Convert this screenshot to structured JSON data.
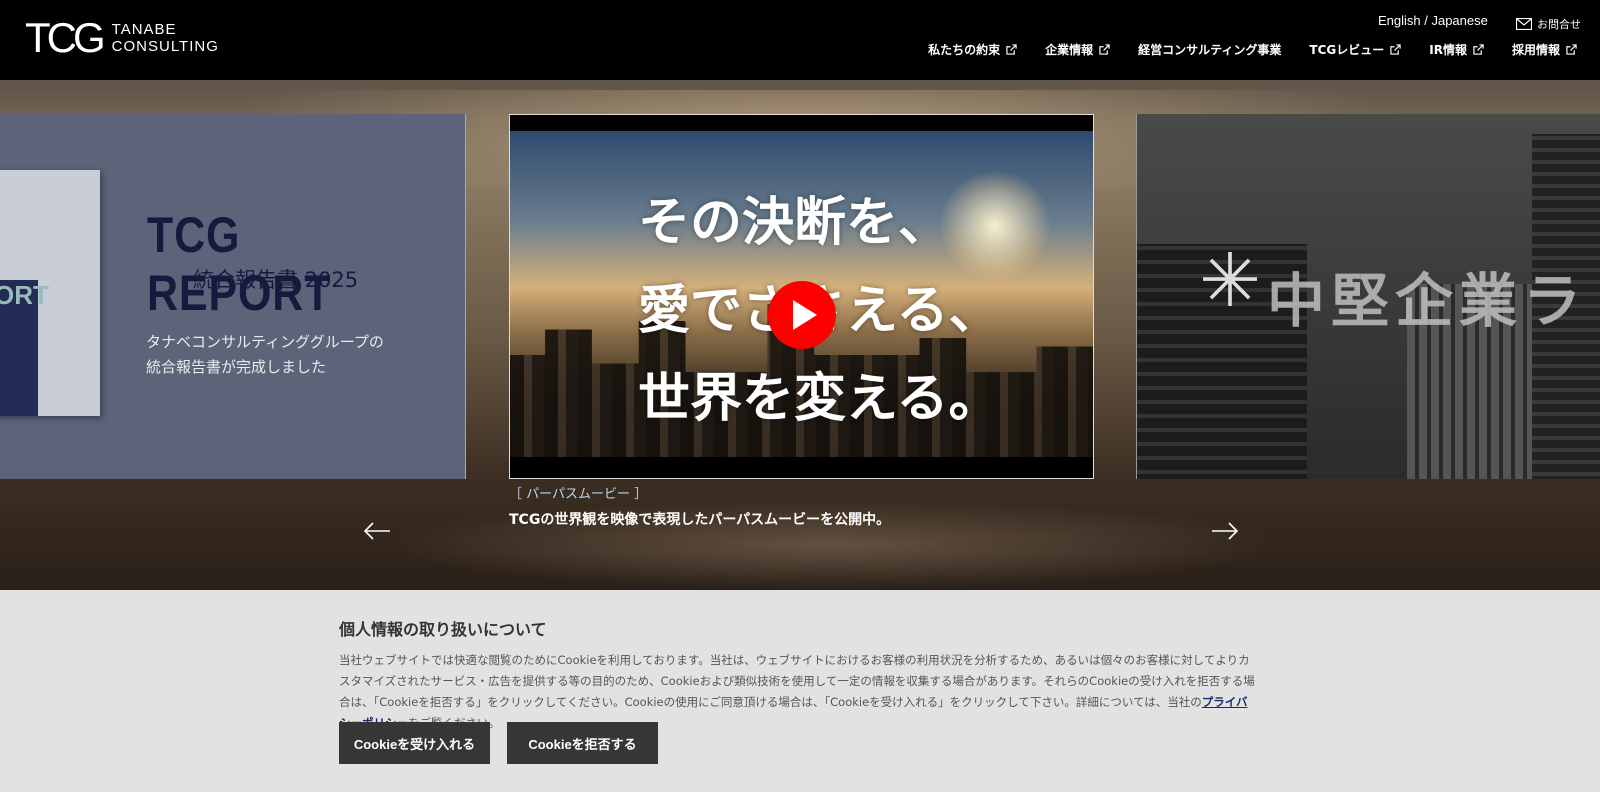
{
  "header": {
    "logo_mark": "TCG",
    "logo_line1": "TANABE",
    "logo_line2": "CONSULTING",
    "language": "English / Japanese",
    "contact": "お問合せ",
    "nav": [
      {
        "label": "私たちの約束",
        "external": true
      },
      {
        "label": "企業情報",
        "external": true
      },
      {
        "label": "経営コンサルティング事業",
        "external": false
      },
      {
        "label": "TCGレビュー",
        "external": true
      },
      {
        "label": "IR情報",
        "external": true
      },
      {
        "label": "採用情報",
        "external": true
      }
    ]
  },
  "carousel": {
    "left_slide": {
      "title": "TCG REPORT",
      "subtitle": "統合報告書 2025",
      "desc_line1": "タナベコンサルティンググループの",
      "desc_line2": "統合報告書が完成しました",
      "book_text": "ORT"
    },
    "center_slide": {
      "video_line1": "その決断を、",
      "video_line2": "愛でささえる、",
      "video_line3": "世界を変える。",
      "caption_tag": "［ パーパスムービー ］",
      "caption_text": "TCGの世界観を映像で表現したパーパスムービーを公開中。"
    },
    "right_slide": {
      "title": "中堅企業ラ"
    },
    "prev_icon": "arrow-left-icon",
    "next_icon": "arrow-right-icon"
  },
  "cookie_banner": {
    "title": "個人情報の取り扱いについて",
    "body_part1": "当社ウェブサイトでは快適な閲覧のためにCookieを利用しております。当社は、ウェブサイトにおけるお客様の利用状況を分析するため、あるいは個々のお客様に対してよりカスタマイズされたサービス・広告を提供する等の目的のため、Cookieおよび類似技術を使用して一定の情報を収集する場合があります。それらのCookieの受け入れを拒否する場合は、「Cookieを拒否する」をクリックしてください。Cookieの使用にご同意頂ける場合は、「Cookieを受け入れる」をクリックして下さい。詳細については、当社の",
    "link_text": "プライバシーポリシー",
    "body_part2": "をご覧ください。",
    "accept_label": "Cookieを受け入れる",
    "reject_label": "Cookieを拒否する"
  },
  "colors": {
    "header_bg": "#000000",
    "cookie_bg": "#e2e2e2",
    "button_bg": "#363636",
    "play_red": "#ff0000",
    "caption_tag": "#bbd6f4",
    "link": "#1a2b6d"
  }
}
